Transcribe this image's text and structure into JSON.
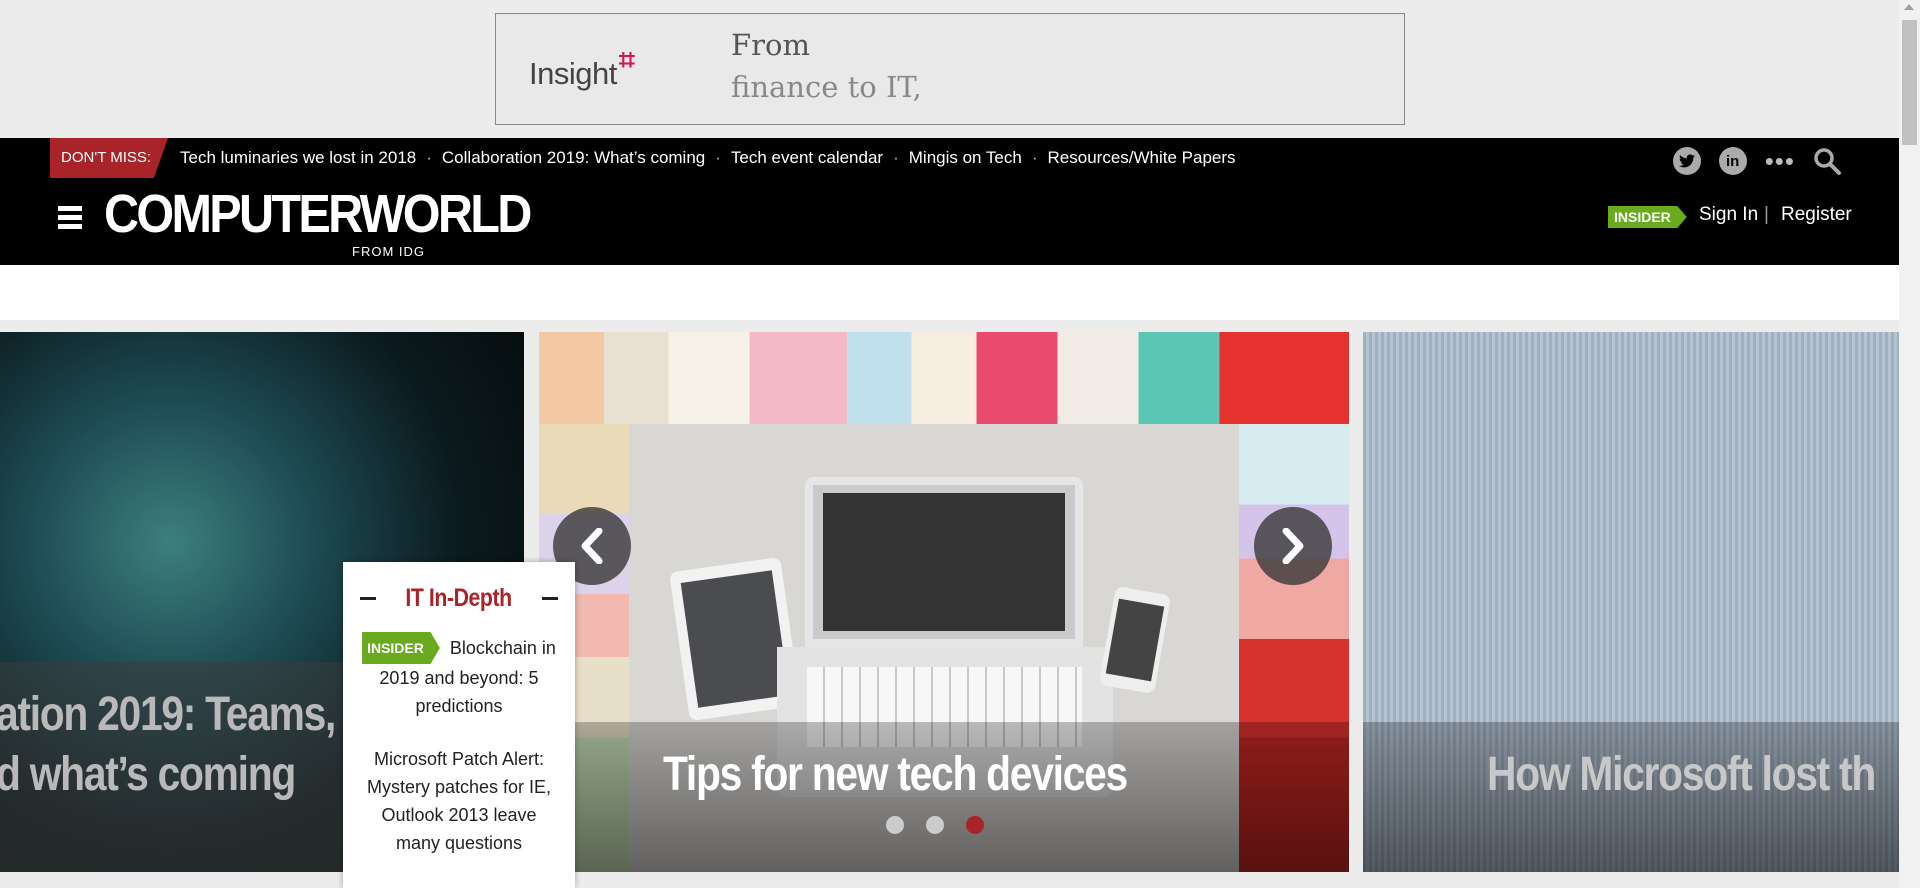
{
  "ad": {
    "logo_text": "Insight",
    "line1": "From",
    "line2": "finance to IT,"
  },
  "header": {
    "dont_miss_label": "DON'T MISS:",
    "nav_links": [
      "Tech luminaries we lost in 2018",
      "Collaboration 2019: What’s coming",
      "Tech event calendar",
      "Mingis on Tech",
      "Resources/White Papers"
    ],
    "separator": "·",
    "logo_text": "COMPUTERWORLD",
    "logo_sub": "FROM IDG",
    "insider_label": "INSIDER",
    "sign_in": "Sign In",
    "pipe": "|",
    "register": "Register",
    "icons": [
      "twitter-icon",
      "linkedin-icon",
      "more-icon",
      "search-icon"
    ],
    "more_glyph": "•••"
  },
  "carousel": {
    "slides": [
      {
        "title_line1": "ation 2019: Teams,",
        "title_line2": "d what’s coming"
      },
      {
        "title": "Tips for new tech devices"
      },
      {
        "title": "How Microsoft lost th"
      }
    ],
    "dot_count": 3,
    "active_dot": 2
  },
  "in_depth": {
    "title": "IT In-Depth",
    "items": [
      {
        "badge": "INSIDER",
        "text": "Blockchain in 2019 and beyond: 5 predictions"
      },
      {
        "text": "Microsoft Patch Alert: Mystery patches for IE, Outlook 2013 leave many questions"
      }
    ]
  },
  "colors": {
    "brand_red": "#a82428",
    "insider_green": "#6aaa1e",
    "header_bg": "#000000"
  }
}
